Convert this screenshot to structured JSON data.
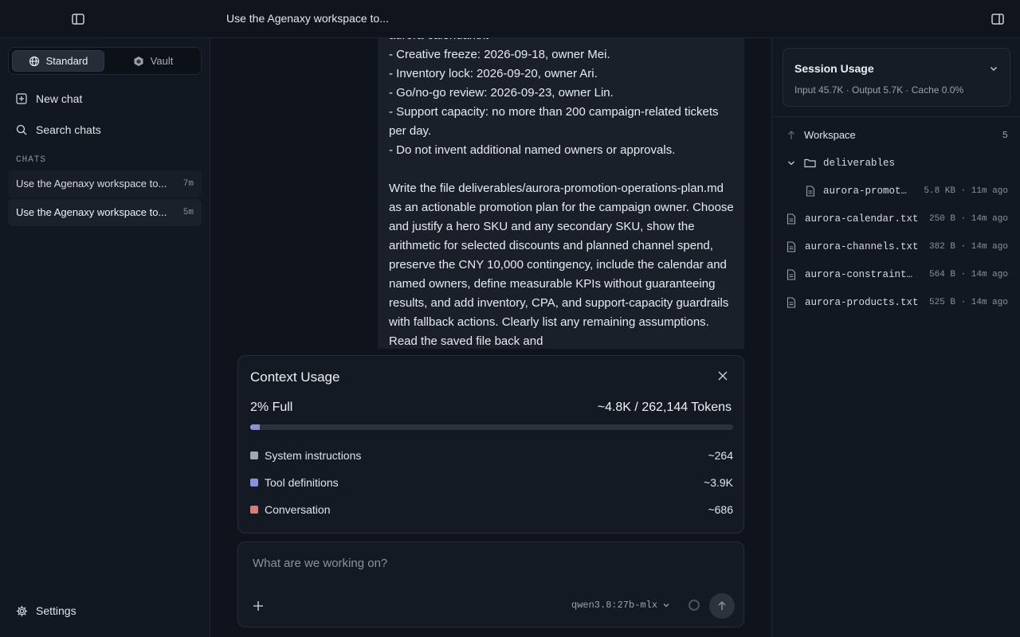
{
  "topbar": {
    "title": "Use the Agenaxy workspace to..."
  },
  "sidebar": {
    "modes": [
      {
        "label": "Standard",
        "icon": "globe-icon",
        "active": true
      },
      {
        "label": "Vault",
        "icon": "hexagon-icon",
        "active": false
      }
    ],
    "new_chat": "New chat",
    "search_chats": "Search chats",
    "chats_label": "CHATS",
    "chats": [
      {
        "title": "Use the Agenaxy workspace to...",
        "age": "7m"
      },
      {
        "title": "Use the Agenaxy workspace to...",
        "age": "5m"
      }
    ],
    "settings": "Settings"
  },
  "message": {
    "text": "aurora-calendar.txt\n- Creative freeze: 2026-09-18, owner Mei.\n- Inventory lock: 2026-09-20, owner Ari.\n- Go/no-go review: 2026-09-23, owner Lin.\n- Support capacity: no more than 200 campaign-related tickets per day.\n- Do not invent additional named owners or approvals.\n\nWrite the file deliverables/aurora-promotion-operations-plan.md as an actionable promotion plan for the campaign owner. Choose and justify a hero SKU and any secondary SKU, show the arithmetic for selected discounts and planned channel spend, preserve the CNY 10,000 contingency, include the calendar and named owners, define measurable KPIs without guaranteeing results, and add inventory, CPA, and support-capacity guardrails with fallback actions. Clearly list any remaining assumptions. Read the saved file back and"
  },
  "context_usage": {
    "title": "Context Usage",
    "percent_label": "2% Full",
    "tokens_label": "~4.8K / 262,144 Tokens",
    "total_tokens": 262144,
    "rows": [
      {
        "label": "System instructions",
        "value": "~264",
        "tokens": 264,
        "color": "#a4a9b1"
      },
      {
        "label": "Tool definitions",
        "value": "~3.9K",
        "tokens": 3900,
        "color": "#8b8fe0"
      },
      {
        "label": "Conversation",
        "value": "~686",
        "tokens": 686,
        "color": "#d77b7b"
      }
    ]
  },
  "composer": {
    "placeholder": "What are we working on?",
    "model": "qwen3.8:27b-mlx"
  },
  "session_usage": {
    "title": "Session Usage",
    "summary": "Input 45.7K · Output 5.7K · Cache 0.0%"
  },
  "workspace": {
    "label": "Workspace",
    "count": "5",
    "folder": {
      "name": "deliverables"
    },
    "files": [
      {
        "name": "aurora-promotion-operations-plan.md",
        "meta": "5.8 KB · 11m ago",
        "nested": true
      },
      {
        "name": "aurora-calendar.txt",
        "meta": "250 B · 14m ago",
        "nested": false
      },
      {
        "name": "aurora-channels.txt",
        "meta": "382 B · 14m ago",
        "nested": false
      },
      {
        "name": "aurora-constraints.txt",
        "meta": "564 B · 14m ago",
        "nested": false
      },
      {
        "name": "aurora-products.txt",
        "meta": "525 B · 14m ago",
        "nested": false
      }
    ]
  }
}
